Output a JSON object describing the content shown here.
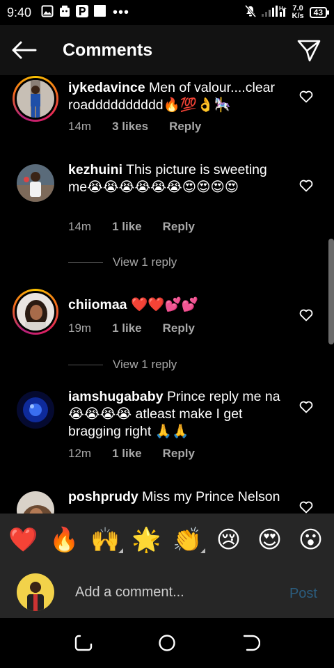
{
  "status_bar": {
    "time": "9:40",
    "net_speed_value": "7.0",
    "net_speed_unit": "K/s",
    "battery": "43"
  },
  "header": {
    "title": "Comments"
  },
  "comments": [
    {
      "username": "iykedavince",
      "text": "Men of valour....clear roadddddddddd🔥💯👌🎠",
      "time": "14m",
      "likes": "3 likes",
      "reply_label": "Reply"
    },
    {
      "username": "kezhuini",
      "text": "This picture is sweeting me😭😭😭😭😭😭😍😍😍😍",
      "time": "14m",
      "likes": "1 like",
      "reply_label": "Reply",
      "view_replies": "View 1 reply"
    },
    {
      "username": "chiiomaa",
      "text": "❤️❤️💕💕",
      "time": "19m",
      "likes": "1 like",
      "reply_label": "Reply",
      "view_replies": "View 1 reply"
    },
    {
      "username": "iamshugababy",
      "text": "Prince reply me na😭😭😭😭 atleast make I get bragging right 🙏🙏",
      "time": "12m",
      "likes": "1 like",
      "reply_label": "Reply"
    },
    {
      "username": "poshprudy",
      "text": "Miss my Prince Nelson"
    }
  ],
  "reactions": [
    "❤️",
    "🔥",
    "🙌",
    "🌟",
    "👏",
    "😢",
    "😍",
    "😮"
  ],
  "composer": {
    "placeholder": "Add a comment...",
    "post_label": "Post"
  },
  "colors": {
    "background": "#000000",
    "header": "#121212",
    "composer": "#262626",
    "muted_text": "#a8a8a8",
    "post_disabled": "#2b5d7f"
  }
}
